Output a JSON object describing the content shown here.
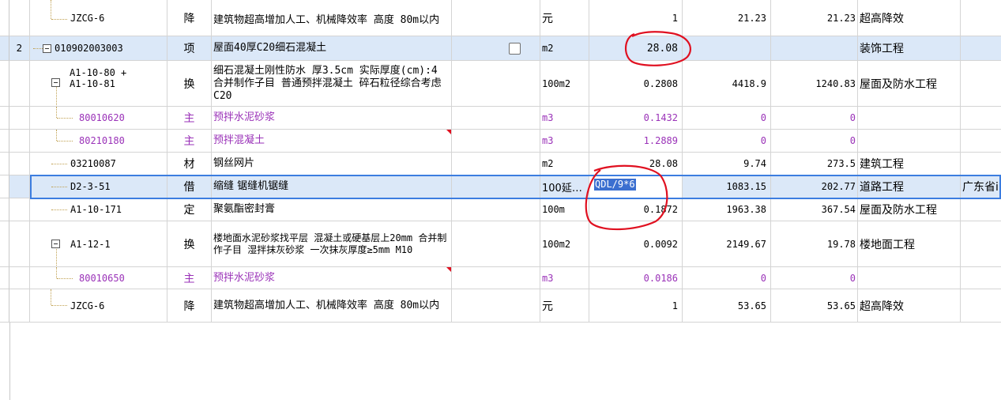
{
  "rows": [
    {
      "num": "",
      "code": "JZCG-6",
      "type": "降",
      "name": "建筑物超高增加人工、机械降效率 高度 80m以内",
      "unit": "元",
      "qty": "1",
      "price": "21.23",
      "total": "21.23",
      "specialty": "超高降效",
      "extra": ""
    },
    {
      "num": "2",
      "code": "010902003003",
      "type": "项",
      "name": "屋面40厚C20细石混凝土",
      "unit": "m2",
      "qty": "28.08",
      "price": "",
      "total": "",
      "specialty": "装饰工程",
      "extra": ""
    },
    {
      "num": "",
      "code": "A1-10-80 + A1-10-81",
      "code_line1": "A1-10-80 +",
      "code_line2": "A1-10-81",
      "type": "换",
      "name": "细石混凝土刚性防水 厚3.5cm  实际厚度(cm):4  合并制作子目 普通预拌混凝土 碎石粒径综合考虑 C20",
      "unit": "100m2",
      "qty": "0.2808",
      "price": "4418.9",
      "total": "1240.83",
      "specialty": "屋面及防水工程",
      "extra": ""
    },
    {
      "num": "",
      "code": "80010620",
      "type": "主",
      "name": "预拌水泥砂浆",
      "unit": "m3",
      "qty": "0.1432",
      "price": "0",
      "total": "0",
      "specialty": "",
      "extra": ""
    },
    {
      "num": "",
      "code": "80210180",
      "type": "主",
      "name": "预拌混凝土",
      "unit": "m3",
      "qty": "1.2889",
      "price": "0",
      "total": "0",
      "specialty": "",
      "extra": ""
    },
    {
      "num": "",
      "code": "03210087",
      "type": "材",
      "name": "钢丝网片",
      "unit": "m2",
      "qty": "28.08",
      "price": "9.74",
      "total": "273.5",
      "specialty": "建筑工程",
      "extra": ""
    },
    {
      "num": "",
      "code": "D2-3-51",
      "type": "借",
      "name": "缩缝 锯缝机锯缝",
      "unit": "100延…",
      "qty": "QDL/9*6",
      "price": "1083.15",
      "total": "202.77",
      "specialty": "道路工程",
      "extra": "广东省i"
    },
    {
      "num": "",
      "code": "A1-10-171",
      "type": "定",
      "name": "聚氨酯密封膏",
      "unit": "100m",
      "qty": "0.1872",
      "price": "1963.38",
      "total": "367.54",
      "specialty": "屋面及防水工程",
      "extra": ""
    },
    {
      "num": "",
      "code": "A1-12-1",
      "type": "换",
      "name": "楼地面水泥砂浆找平层 混凝土或硬基层上20mm  合并制作子目 湿拌抹灰砂浆 一次抹灰厚度≥5mm M10",
      "unit": "100m2",
      "qty": "0.0092",
      "price": "2149.67",
      "total": "19.78",
      "specialty": "楼地面工程",
      "extra": ""
    },
    {
      "num": "",
      "code": "80010650",
      "type": "主",
      "name": "预拌水泥砂浆",
      "unit": "m3",
      "qty": "0.0186",
      "price": "0",
      "total": "0",
      "specialty": "",
      "extra": ""
    },
    {
      "num": "",
      "code": "JZCG-6",
      "type": "降",
      "name": "建筑物超高增加人工、机械降效率 高度 80m以内",
      "unit": "元",
      "qty": "1",
      "price": "53.65",
      "total": "53.65",
      "specialty": "超高降效",
      "extra": ""
    }
  ],
  "colors": {
    "highlight": "#dbe8f8",
    "selection": "#3c7de0",
    "purple_text": "#9a32b8",
    "annotation_red": "#e01020",
    "grid_line": "#d4d4d4"
  }
}
